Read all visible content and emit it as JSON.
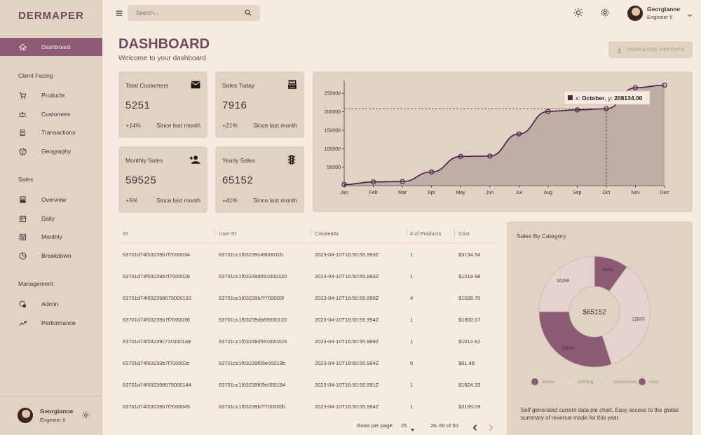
{
  "brand": "DERMAPER",
  "nav": {
    "dashboard": "Dashboard",
    "client_label": "Client Facing",
    "products": "Products",
    "customers": "Customers",
    "transactions": "Transactions",
    "geography": "Geography",
    "sales_label": "Sales",
    "overview": "Overview",
    "daily": "Daily",
    "monthly": "Monthly",
    "breakdown": "Breakdown",
    "management_label": "Management",
    "admin": "Admin",
    "performance": "Performance"
  },
  "user": {
    "name": "Georgianne",
    "role": "Engineer II"
  },
  "search": {
    "placeholder": "Search..."
  },
  "header": {
    "title": "DASHBOARD",
    "subtitle": "Welcome to your dashboard",
    "download": "DOWNLOAD REPORTS"
  },
  "stats": {
    "total_customers": {
      "title": "Total Customers",
      "value": "5251",
      "pct": "+14%",
      "since": "Since last month",
      "icon": "mail-icon"
    },
    "sales_today": {
      "title": "Sales Today",
      "value": "7916",
      "pct": "+21%",
      "since": "Since last month",
      "icon": "point-of-sale-icon"
    },
    "monthly_sales": {
      "title": "Monthly Sales",
      "value": "59525",
      "pct": "+5%",
      "since": "Since last month",
      "icon": "person-add-icon"
    },
    "yearly_sales": {
      "title": "Yearly Sales",
      "value": "65152",
      "pct": "+41%",
      "since": "Since last month",
      "icon": "traffic-icon"
    }
  },
  "chart_data": [
    {
      "type": "area",
      "x": [
        "Jan",
        "Feb",
        "Mar",
        "Apr",
        "May",
        "Jun",
        "Jul",
        "Aug",
        "Sep",
        "Oct",
        "Nov",
        "Dec"
      ],
      "series": [
        {
          "values": [
            3000,
            10000,
            11000,
            37000,
            79000,
            80000,
            140000,
            201000,
            205000,
            208134,
            265000,
            272000
          ]
        }
      ],
      "yticks": [
        "50000",
        "100000",
        "150000",
        "200000",
        "250000"
      ],
      "ylim": [
        0,
        275000
      ],
      "tooltip": {
        "prefix": "x:",
        "x": "October",
        "sep": ", y:",
        "y": "208134.00"
      },
      "colors": {
        "line": "#4a1d44",
        "fill": "#baa6a0",
        "marker": "#5a2a54"
      }
    },
    {
      "type": "pie",
      "title": "Sales By Category",
      "center_label": "$65152",
      "slices": [
        {
          "name": "shoes",
          "value": 6515,
          "color": "#8a5b72"
        },
        {
          "name": "clothing",
          "value": 22803,
          "color": "#e6d3d0"
        },
        {
          "name": "accessories",
          "value": 19545,
          "color": "#8a5b72"
        },
        {
          "name": "misc",
          "value": 16288,
          "color": "#e6d3d0"
        }
      ],
      "legend": [
        {
          "name": "shoes",
          "color": "#8a5b72"
        },
        {
          "name": "clothing",
          "color": "#e6d3d0"
        },
        {
          "name": "accessories",
          "color": "#e6d3d0"
        },
        {
          "name": "misc",
          "color": "#8a5b72"
        }
      ],
      "description": "Self generated current data pie chart. Easy access to the global summary of revenue made for this year."
    }
  ],
  "table": {
    "headers": [
      "ID",
      "User ID",
      "CreatedAt",
      "# of Products",
      "Cost"
    ],
    "rows": [
      [
        "63701d74f03239b7f7000034",
        "63701cc1f03239c4900011b",
        "2023-04-10T16:50:55.993Z",
        "1",
        "$3134.54"
      ],
      [
        "63701d74f03239b7f7000028",
        "63701cc1f03239d591000320",
        "2023-04-10T16:50:55.993Z",
        "1",
        "$1219.98"
      ],
      [
        "63701d74f032398675000132",
        "63701cc1f03239b7f700000f",
        "2023-04-10T16:50:55.990Z",
        "4",
        "$1028.70"
      ],
      [
        "63701d74f03239b7f7000036",
        "63701cc1f03239db69000120",
        "2023-04-10T16:50:55.994Z",
        "1",
        "$1800.07"
      ],
      [
        "63701d74f03239c72c0001a9",
        "63701cc1f03239d591000323",
        "2023-04-10T16:50:55.989Z",
        "1",
        "$1012.62"
      ],
      [
        "63701d74f03239b7f700003c",
        "63701cc1f03239f09e00018b",
        "2023-04-10T16:50:55.994Z",
        "5",
        "$61.48"
      ],
      [
        "63701d74f032398675000144",
        "63701cc1f03239f09e000184",
        "2023-04-10T16:50:55.991Z",
        "1",
        "$1824.33"
      ],
      [
        "63701d74f03239b7f7000045",
        "63701cc1f03239b7f700000b",
        "2023-04-10T16:50:55.994Z",
        "1",
        "$3199.09"
      ]
    ],
    "pager": {
      "rows_label": "Rows per page:",
      "rows_value": "25",
      "range": "26–50 of 50"
    }
  }
}
